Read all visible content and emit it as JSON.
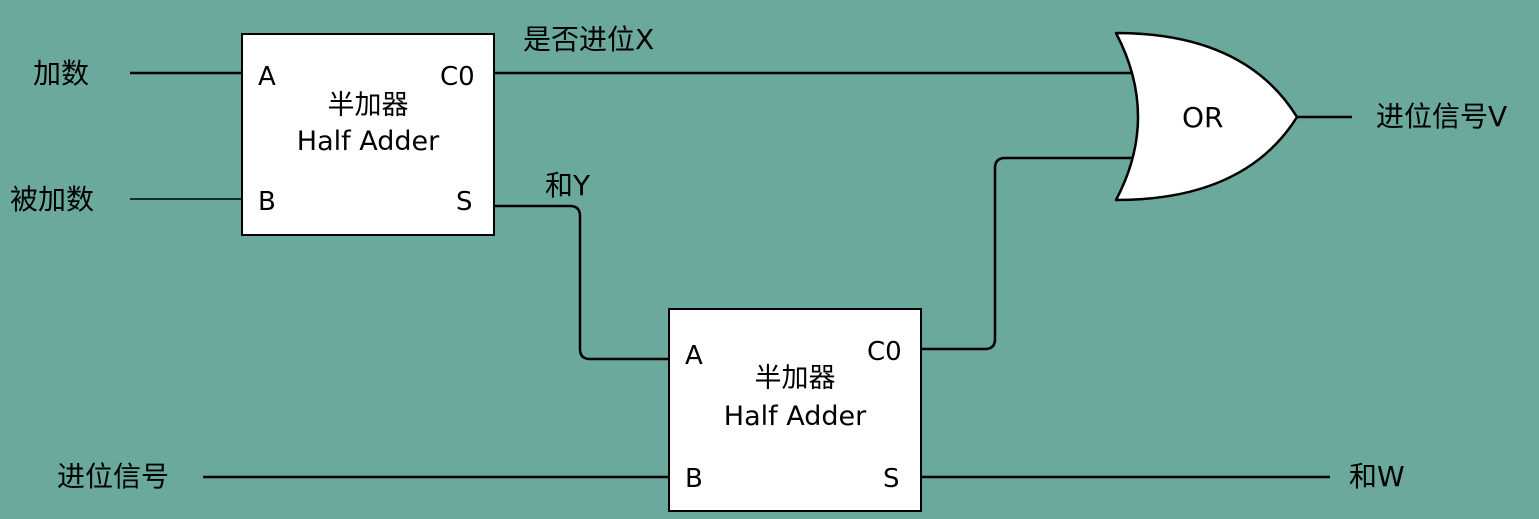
{
  "inputs": {
    "addend": "加数",
    "augend": "被加数",
    "carry_in": "进位信号"
  },
  "signals": {
    "carry_x": "是否进位X",
    "sum_y": "和Y",
    "carry_out_v": "进位信号V",
    "sum_w": "和W"
  },
  "half_adder_1": {
    "title_cn": "半加器",
    "title_en": "Half Adder",
    "pin_a": "A",
    "pin_b": "B",
    "pin_c0": "C0",
    "pin_s": "S"
  },
  "half_adder_2": {
    "title_cn": "半加器",
    "title_en": "Half Adder",
    "pin_a": "A",
    "pin_b": "B",
    "pin_c0": "C0",
    "pin_s": "S"
  },
  "or_gate": {
    "label": "OR"
  },
  "colors": {
    "background": "#6aa99b",
    "block_fill": "#ffffff",
    "stroke": "#000000"
  }
}
